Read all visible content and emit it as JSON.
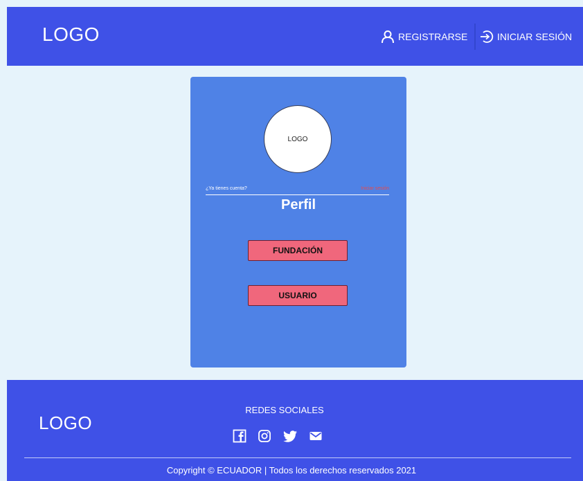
{
  "header": {
    "logo": "LOGO",
    "register_label": "REGISTRARSE",
    "login_label": "INICIAR SESIÓN"
  },
  "card": {
    "logo": "LOGO",
    "account_question": "¿Ya tienes cuenta?",
    "login_link": "Iniciar sesión",
    "title": "Perfil",
    "buttons": {
      "fundacion": "FUNDACIÓN",
      "usuario": "USUARIO"
    }
  },
  "footer": {
    "logo": "LOGO",
    "social_title": "REDES SOCIALES",
    "social_icons": [
      "facebook-icon",
      "instagram-icon",
      "twitter-icon",
      "mail-icon"
    ],
    "copyright": "Copyright © ECUADOR  |  Todos los derechos reservados 2021"
  },
  "colors": {
    "primary": "#3f51e7",
    "card": "#4f82e6",
    "background": "#e6f3fb",
    "button": "#f0677c",
    "link": "#e84a4a"
  }
}
